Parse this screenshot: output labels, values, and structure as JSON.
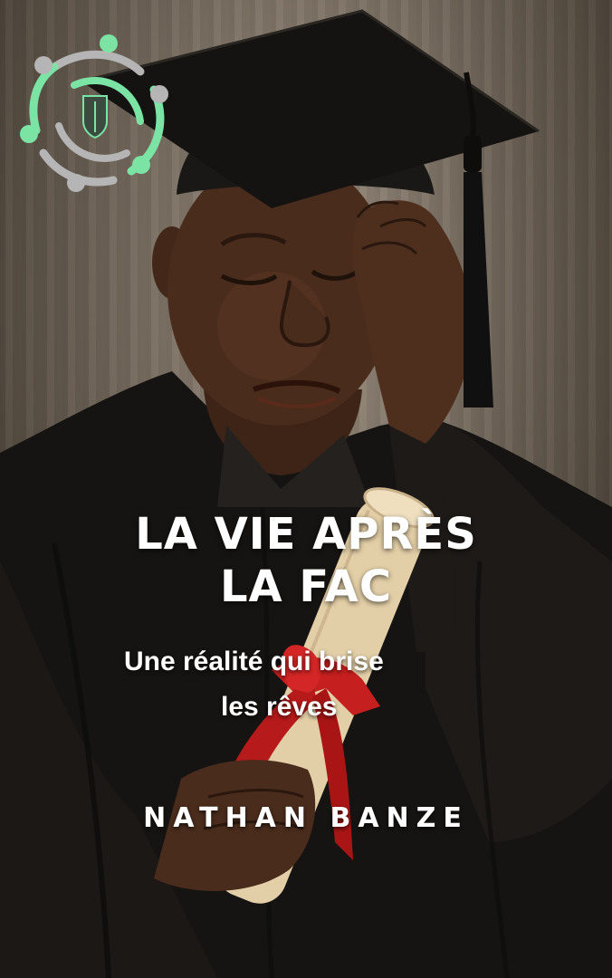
{
  "cover": {
    "title_line1": "LA VIE APRÈS",
    "title_line2": "LA FAC",
    "subtitle_line1": "Une réalité qui brise",
    "subtitle_line2": "les rêves",
    "author": "NATHAN BANZE"
  },
  "logo": {
    "icon": "circle-of-people-logo-icon",
    "colors": {
      "green": "#7be3a4",
      "grey": "#b5b5b5"
    }
  },
  "illustration": {
    "icon": "crying-graduate-with-diploma-icon",
    "colors": {
      "gown": "#161412",
      "skin": "#4a2c1c",
      "diploma": "#e3cfa7",
      "ribbon": "#c61f1f"
    }
  }
}
